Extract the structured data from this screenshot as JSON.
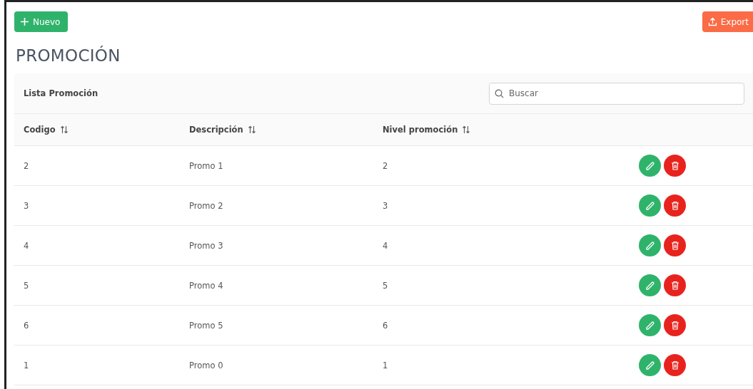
{
  "toolbar": {
    "new_button": "Nuevo",
    "export_button": "Export"
  },
  "title": "PROMOCIÓN",
  "table": {
    "caption": "Lista Promoción",
    "search": {
      "placeholder": "Buscar"
    },
    "columns": [
      "Codigo",
      "Descripción",
      "Nivel promoción"
    ],
    "rows": [
      {
        "cells": [
          "2",
          "Promo 1",
          "2"
        ]
      },
      {
        "cells": [
          "3",
          "Promo 2",
          "3"
        ]
      },
      {
        "cells": [
          "4",
          "Promo 3",
          "4"
        ]
      },
      {
        "cells": [
          "5",
          "Promo 4",
          "5"
        ]
      },
      {
        "cells": [
          "6",
          "Promo 5",
          "6"
        ]
      },
      {
        "cells": [
          "1",
          "Promo 0",
          "1"
        ]
      }
    ]
  }
}
